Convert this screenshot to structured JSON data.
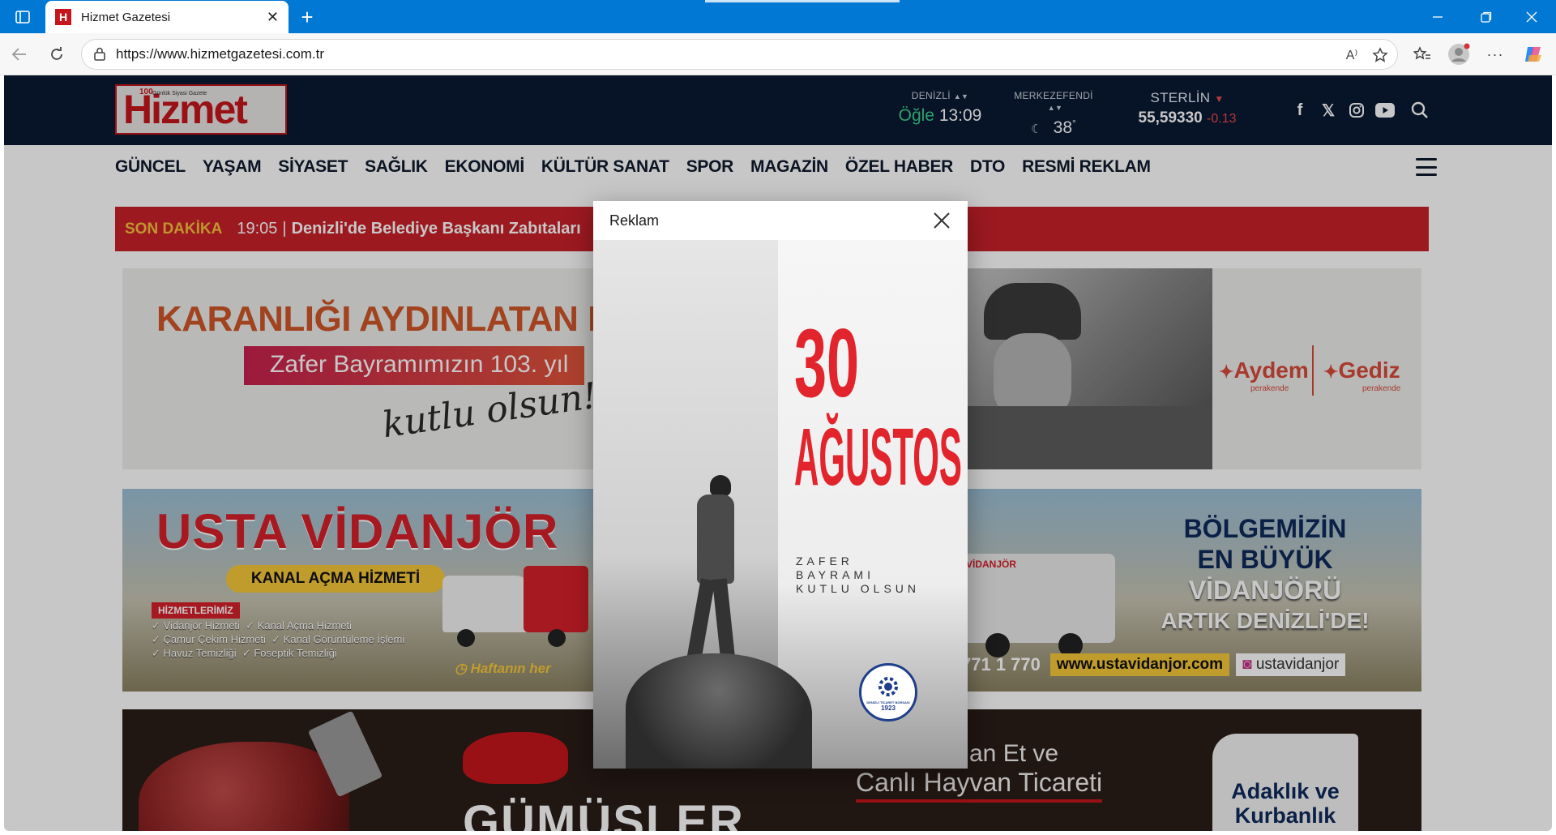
{
  "browser": {
    "tab_title": "Hizmet Gazetesi",
    "favicon_letter": "H",
    "url": "https://www.hizmetgazetesi.com.tr"
  },
  "header": {
    "logo_text": "Hizmet",
    "logo_badge": "100",
    "logo_tagline": "Günlük Siyasi Gazete",
    "prayer": {
      "city": "DENİZLİ",
      "name": "Öğle",
      "time": "13:09"
    },
    "weather": {
      "city": "MERKEZEFENDİ",
      "temp": "38",
      "unit": "°"
    },
    "currency": {
      "name": "STERLİN",
      "value": "55,59330",
      "change": "-0.13"
    }
  },
  "nav": {
    "items": [
      "GÜNCEL",
      "YAŞAM",
      "SİYASET",
      "SAĞLIK",
      "EKONOMİ",
      "KÜLTÜR SANAT",
      "SPOR",
      "MAGAZİN",
      "ÖZEL HABER",
      "DTO",
      "RESMİ REKLAM"
    ]
  },
  "breaking": {
    "label": "SON DAKİKA",
    "time": "19:05",
    "separator": "|",
    "headline": "Denizli'de Belediye Başkanı Zabıtaları"
  },
  "banner1": {
    "headline": "KARANLIĞI AYDINLATAN B",
    "sub": "Zafer Bayramımızın 103. yıl",
    "script": "kutlu olsun!",
    "brand1": "Aydem",
    "brand2": "Gediz",
    "brand_sub": "perakende"
  },
  "banner2": {
    "headline": "USTA VİDANJÖR",
    "service": "KANAL AÇMA HİZMETİ",
    "services_title": "HİZMETLERİMİZ",
    "services": [
      "Vidanjör Hizmeti",
      "Kanal Açma Hizmeti",
      "Çamur Çekim Hizmeti",
      "Kanal Görüntüleme İşlemi",
      "Havuz Temizliği",
      "Foseptik Temizliği"
    ],
    "week": "Haftanın her",
    "truck_label": "VİDANJÖR",
    "right_lines": [
      "BÖLGEMİZİN",
      "EN BÜYÜK",
      "VİDANJÖRÜ",
      "ARTIK DENİZLİ'DE!"
    ],
    "phone": "771 1 770",
    "website": "www.ustavidanjor.com",
    "instagram": "ustavidanjor"
  },
  "banner3": {
    "headline": "GÜMÜŞLER",
    "line1": "an Et ve",
    "line2": "Canlı Hayvan Ticareti",
    "sticker": [
      "Adaklık ve",
      "Kurbanlık"
    ]
  },
  "modal": {
    "title": "Reklam",
    "ad_big1": "30",
    "ad_big2": "AĞUSTOS",
    "ad_lines": [
      "ZAFER",
      "BAYRAMI",
      "KUTLU OLSUN"
    ],
    "seal_text": "DENİZLİ TİCARET BORSASI",
    "seal_year": "1923"
  },
  "colors": {
    "titlebar": "#0078d4",
    "header_bg": "#0a1a33",
    "brand_red": "#c4161c",
    "breaking_bg": "#c8202a",
    "breaking_label": "#f6c03c"
  }
}
